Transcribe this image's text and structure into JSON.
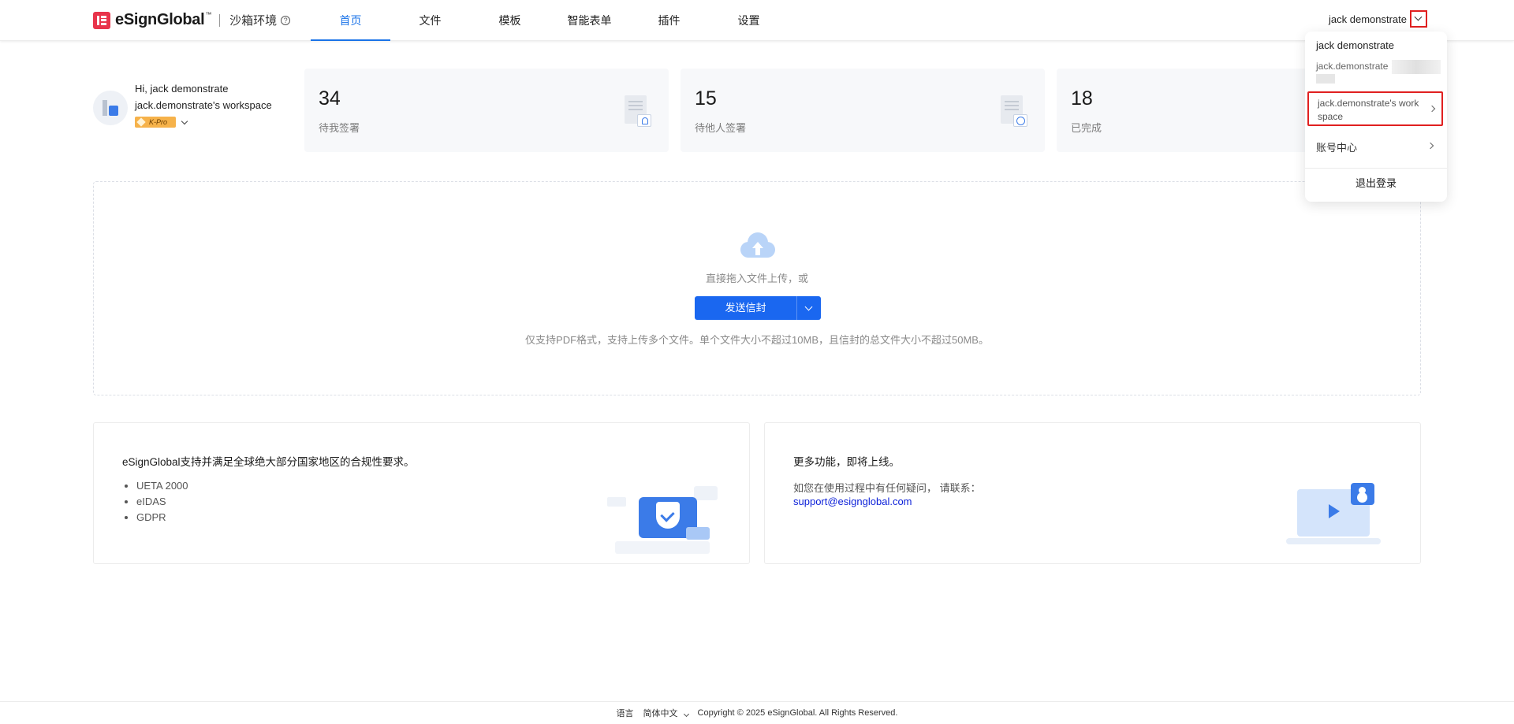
{
  "header": {
    "brand": "eSignGlobal",
    "brand_tm": "™",
    "sandbox_label": "沙箱环境",
    "nav": [
      "首页",
      "文件",
      "模板",
      "智能表单",
      "插件",
      "设置"
    ],
    "active_nav": "首页",
    "user_name": "jack demonstrate"
  },
  "welcome": {
    "greeting": "Hi, jack demonstrate",
    "workspace": "jack.demonstrate's workspace",
    "plan_badge": "K-Pro"
  },
  "stats": [
    {
      "value": "34",
      "label": "待我签署"
    },
    {
      "value": "15",
      "label": "待他人签署"
    },
    {
      "value": "18",
      "label": "已完成"
    }
  ],
  "upload": {
    "drop_text": "直接拖入文件上传，或",
    "send_button": "发送信封",
    "hint": "仅支持PDF格式，支持上传多个文件。单个文件大小不超过10MB，且信封的总文件大小不超过50MB。"
  },
  "compliance": {
    "title": "eSignGlobal支持并满足全球绝大部分国家地区的合规性要求。",
    "items": [
      "UETA 2000",
      "eIDAS",
      "GDPR"
    ]
  },
  "more": {
    "title": "更多功能，即将上线。",
    "contact_text": "如您在使用过程中有任何疑问， 请联系：",
    "email": "support@esignglobal.com"
  },
  "footer": {
    "lang_label": "语言",
    "lang_value": "简体中文",
    "copyright": "Copyright © 2025 eSignGlobal. All Rights Reserved."
  },
  "dropdown": {
    "name": "jack demonstrate",
    "email_prefix": "jack.demonstrate",
    "workspace": "jack.demonstrate's work space",
    "account_center": "账号中心",
    "logout": "退出登录"
  },
  "colors": {
    "accent": "#1a67f0",
    "highlight": "#e02020",
    "logo": "#e8344b"
  }
}
